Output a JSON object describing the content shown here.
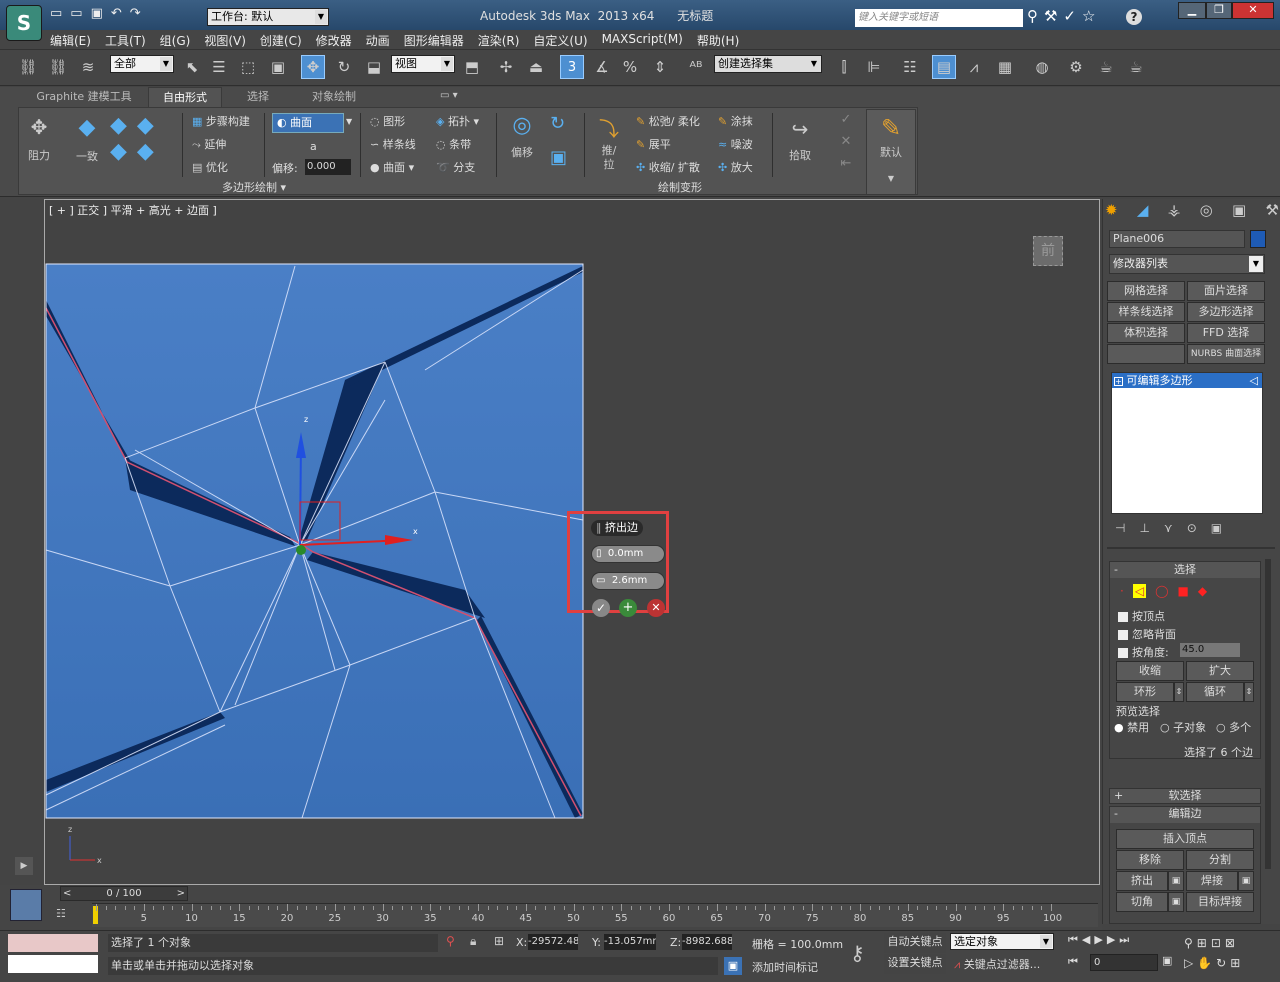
{
  "title": {
    "app": "Autodesk 3ds Max",
    "ver": "2013 x64",
    "doc": "无标题",
    "workspace": "工作台: 默认",
    "search_placeholder": "键入关键字或短语"
  },
  "menu": [
    "编辑(E)",
    "工具(T)",
    "组(G)",
    "视图(V)",
    "创建(C)",
    "修改器",
    "动画",
    "图形编辑器",
    "渲染(R)",
    "自定义(U)",
    "MAXScript(M)",
    "帮助(H)"
  ],
  "toolbar": {
    "filter": "全部",
    "refcoord": "视图",
    "selset": "创建选择集",
    "snap": "3"
  },
  "ribbon": {
    "tabs": [
      "Graphite 建模工具",
      "自由形式",
      "选择",
      "对象绘制"
    ],
    "active_tab": "自由形式",
    "drag": "阻力",
    "conform": "一致",
    "step": "步骤构建",
    "extend": "延伸",
    "optimize": "优化",
    "surface": "曲面",
    "surface_val": "a",
    "offset_label": "偏移:",
    "offset_val": "0.000",
    "shape": "图形",
    "spline": "样条线",
    "curve": "曲面",
    "topology": "拓扑",
    "strip": "条带",
    "branch": "分支",
    "group1": "多边形绘制",
    "offset": "偏移",
    "pushpull": "推/拉",
    "relax": "松弛/ 柔化",
    "flatten": "展平",
    "shrink": "收缩/ 扩散",
    "smudge": "涂抹",
    "noise": "噪波",
    "amplify": "放大",
    "pick": "拾取",
    "default": "默认",
    "group2": "绘制变形"
  },
  "viewport": {
    "label": "[ + ] 正交 ] 平滑 + 高光 + 边面 ]",
    "viewcube": "前"
  },
  "caddy": {
    "title": "挤出边",
    "height": "0.0mm",
    "width": "2.6mm"
  },
  "panel": {
    "object_name": "Plane006",
    "modifier_list": "修改器列表",
    "mod_buttons": [
      "网格选择",
      "面片选择",
      "样条线选择",
      "多边形选择",
      "体积选择",
      "FFD 选择",
      "",
      "NURBS 曲面选择"
    ],
    "stack_item": "可编辑多边形",
    "rollout_select": "选择",
    "by_vertex": "按顶点",
    "ignore_back": "忽略背面",
    "by_angle": "按角度:",
    "angle_val": "45.0",
    "shrink": "收缩",
    "grow": "扩大",
    "ring": "环形",
    "loop": "循环",
    "preview": "预览选择",
    "disable": "禁用",
    "subobj": "子对象",
    "multi": "多个",
    "sel_count": "选择了 6 个边",
    "soft_sel": "软选择",
    "edit_edges": "编辑边",
    "insert_vertex": "插入顶点",
    "remove": "移除",
    "split": "分割",
    "extrude": "挤出",
    "weld": "焊接",
    "chamfer": "切角",
    "target_weld": "目标焊接"
  },
  "timeline": {
    "frame": "0 / 100",
    "ticks": [
      "5",
      "10",
      "15",
      "20",
      "25",
      "30",
      "35",
      "40",
      "45",
      "50",
      "55",
      "60",
      "65",
      "70",
      "75",
      "80",
      "85",
      "90",
      "95",
      "100"
    ]
  },
  "status": {
    "sel": "选择了 1 个对象",
    "prompt": "单击或单击并拖动以选择对象",
    "x": "-29572.48",
    "y": "-13.057mm",
    "z": "-8982.688",
    "grid": "栅格 = 100.0mm",
    "addtime": "添加时间标记",
    "autokey": "自动关键点",
    "setkey": "设置关键点",
    "selobj": "选定对象",
    "keyfilter": "关键点过滤器...",
    "frame": "0"
  },
  "colors": {
    "viewport_bg": "#434343",
    "plane": "#4f86c9",
    "highlight": "#e04040"
  }
}
